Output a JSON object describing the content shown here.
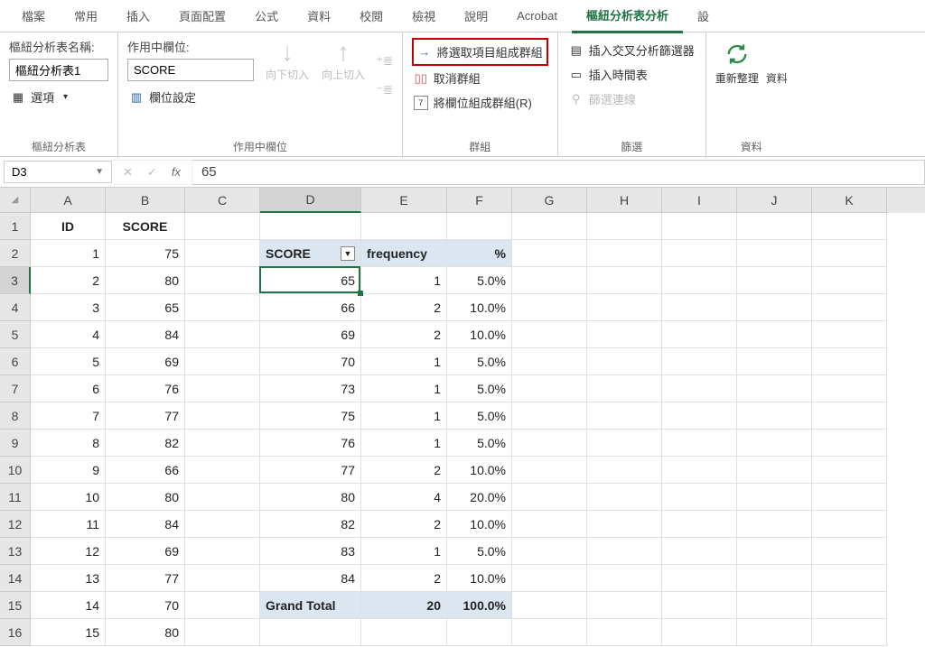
{
  "tabs": {
    "items": [
      "檔案",
      "常用",
      "插入",
      "頁面配置",
      "公式",
      "資料",
      "校閱",
      "檢視",
      "說明",
      "Acrobat",
      "樞紐分析表分析",
      "設"
    ],
    "active": 10
  },
  "ribbon": {
    "g1": {
      "name_lbl": "樞紐分析表名稱:",
      "name_val": "樞紐分析表1",
      "options": "選項",
      "group": "樞紐分析表"
    },
    "g2": {
      "field_lbl": "作用中欄位:",
      "field_val": "SCORE",
      "settings": "欄位設定",
      "down": "向下切入",
      "up": "向上切入",
      "group": "作用中欄位"
    },
    "g3": {
      "sel": "將選取項目組成群組",
      "ungroup": "取消群組",
      "fld": "將欄位組成群組(R)",
      "group": "群組"
    },
    "g4": {
      "slicer": "插入交叉分析篩選器",
      "timeline": "插入時間表",
      "conn": "篩選連線",
      "group": "篩選"
    },
    "g5": {
      "refresh": "重新整理",
      "data": "資料",
      "group": "資料"
    }
  },
  "namebox": "D3",
  "formula_value": "65",
  "columns": [
    "A",
    "B",
    "C",
    "D",
    "E",
    "F",
    "G",
    "H",
    "I",
    "J",
    "K"
  ],
  "rows": [
    {
      "n": 1,
      "A": "ID",
      "B": "SCORE",
      "Aalign": "c",
      "Balign": "c"
    },
    {
      "n": 2,
      "A": "1",
      "B": "75",
      "D": "SCORE",
      "E": "frequency",
      "F": "%",
      "pvhdr": true,
      "dd": true
    },
    {
      "n": 3,
      "A": "2",
      "B": "80",
      "D": "65",
      "E": "1",
      "F": "5.0%",
      "sel": true
    },
    {
      "n": 4,
      "A": "3",
      "B": "65",
      "D": "66",
      "E": "2",
      "F": "10.0%"
    },
    {
      "n": 5,
      "A": "4",
      "B": "84",
      "D": "69",
      "E": "2",
      "F": "10.0%"
    },
    {
      "n": 6,
      "A": "5",
      "B": "69",
      "D": "70",
      "E": "1",
      "F": "5.0%"
    },
    {
      "n": 7,
      "A": "6",
      "B": "76",
      "D": "73",
      "E": "1",
      "F": "5.0%"
    },
    {
      "n": 8,
      "A": "7",
      "B": "77",
      "D": "75",
      "E": "1",
      "F": "5.0%"
    },
    {
      "n": 9,
      "A": "8",
      "B": "82",
      "D": "76",
      "E": "1",
      "F": "5.0%"
    },
    {
      "n": 10,
      "A": "9",
      "B": "66",
      "D": "77",
      "E": "2",
      "F": "10.0%"
    },
    {
      "n": 11,
      "A": "10",
      "B": "80",
      "D": "80",
      "E": "4",
      "F": "20.0%"
    },
    {
      "n": 12,
      "A": "11",
      "B": "84",
      "D": "82",
      "E": "2",
      "F": "10.0%"
    },
    {
      "n": 13,
      "A": "12",
      "B": "69",
      "D": "83",
      "E": "1",
      "F": "5.0%"
    },
    {
      "n": 14,
      "A": "13",
      "B": "77",
      "D": "84",
      "E": "2",
      "F": "10.0%"
    },
    {
      "n": 15,
      "A": "14",
      "B": "70",
      "D": "Grand Total",
      "E": "20",
      "F": "100.0%",
      "pvtot": true
    },
    {
      "n": 16,
      "A": "15",
      "B": "80"
    }
  ],
  "active_cell": {
    "row": 3,
    "col": "D"
  }
}
